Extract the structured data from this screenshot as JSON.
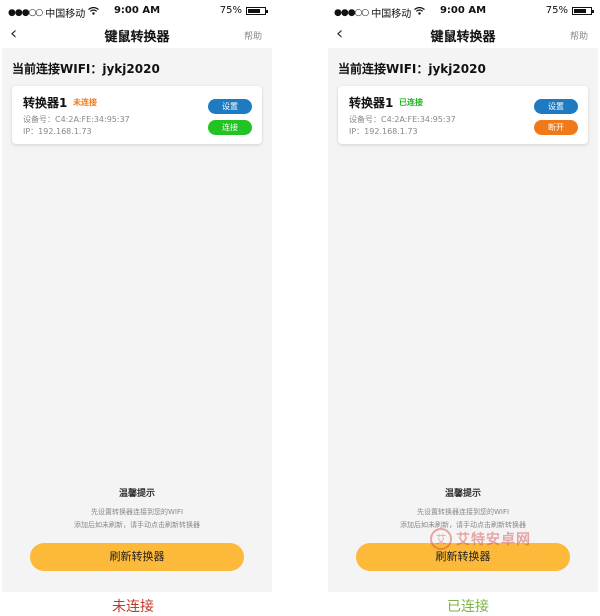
{
  "screens": [
    {
      "status_bar": {
        "carrier": "中国移动",
        "time": "9:00 AM",
        "battery": "75%",
        "battery_level": 0.75
      },
      "nav": {
        "title": "键鼠转换器",
        "help": "帮助"
      },
      "wifi_label": "当前连接WIFI：jykj2020",
      "device": {
        "name": "转换器1",
        "status": "未连接",
        "status_color": "#f07a1a",
        "id": "设备号：C4:2A:FE:34:95:37",
        "ip": "IP：192.168.1.73",
        "top_button": "设置",
        "bottom_button": "连接",
        "bottom_button_color": "#22c322"
      },
      "tips": {
        "title": "温馨提示",
        "line1": "先设置转换器连接到您的WIFI",
        "line2": "添加后如未刷新，请手动点击刷新转换器"
      },
      "refresh_button": "刷新转换器",
      "caption": "未连接"
    },
    {
      "status_bar": {
        "carrier": "中国移动",
        "time": "9:00 AM",
        "battery": "75%",
        "battery_level": 0.75
      },
      "nav": {
        "title": "键鼠转换器",
        "help": "帮助"
      },
      "wifi_label": "当前连接WIFI：jykj2020",
      "device": {
        "name": "转换器1",
        "status": "已连接",
        "status_color": "#22b322",
        "id": "设备号：C4:2A:FE:34:95:37",
        "ip": "IP：192.168.1.73",
        "top_button": "设置",
        "bottom_button": "断开",
        "bottom_button_color": "#f07a1a"
      },
      "tips": {
        "title": "温馨提示",
        "line1": "先设置转换器连接到您的WIFI",
        "line2": "添加后如未刷新，请手动点击刷新转换器"
      },
      "refresh_button": "刷新转换器",
      "caption": "已连接"
    }
  ],
  "watermark": {
    "mark": "艾",
    "text": "艾特安卓网"
  }
}
